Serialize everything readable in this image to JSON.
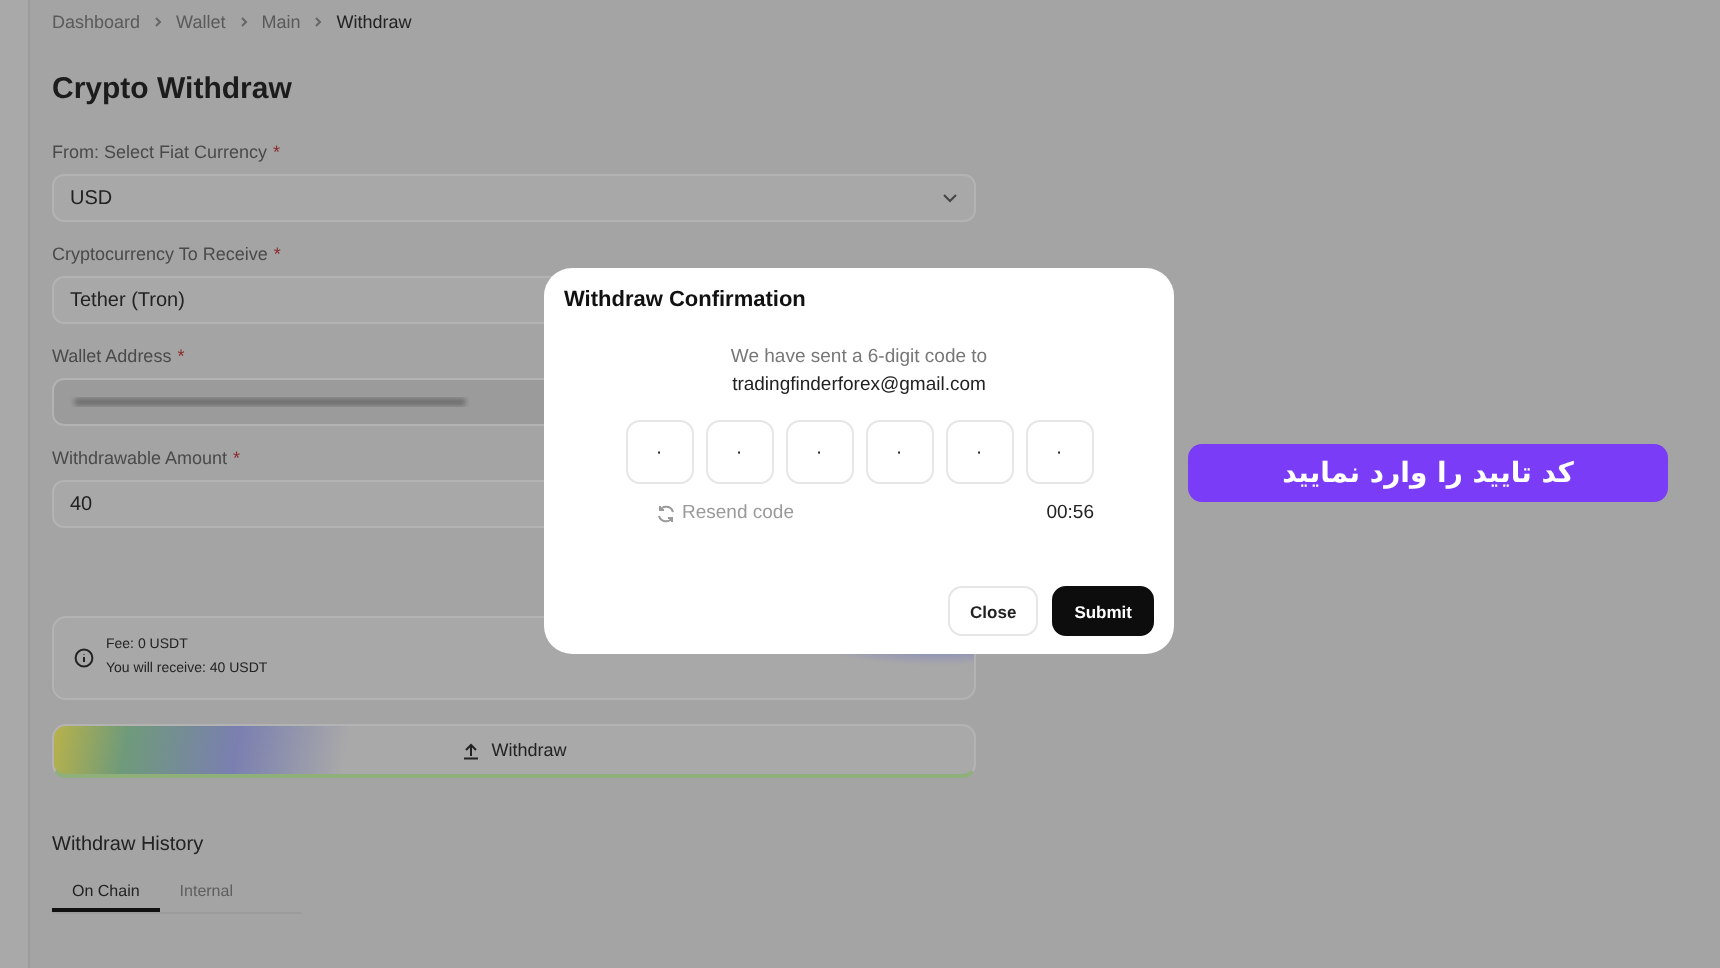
{
  "breadcrumb": [
    "Dashboard",
    "Wallet",
    "Main",
    "Withdraw"
  ],
  "page_title": "Crypto Withdraw",
  "form": {
    "fields": [
      {
        "kind": "select",
        "label": "From: Select Fiat Currency",
        "required_mark": "*",
        "value": "USD"
      },
      {
        "kind": "text",
        "label": "Cryptocurrency To Receive",
        "required_mark": "*",
        "value": "Tether (Tron)"
      },
      {
        "kind": "hidden",
        "label": "Wallet Address",
        "required_mark": "*"
      },
      {
        "kind": "text",
        "label": "Withdrawable Amount",
        "required_mark": "*",
        "value": "40"
      }
    ]
  },
  "summary": {
    "fee": "Fee: 0 USDT",
    "receive": "You will receive: 40 USDT"
  },
  "withdraw_button": "Withdraw",
  "history": {
    "title": "Withdraw History",
    "tabs": [
      {
        "label": "On Chain",
        "selected": true
      },
      {
        "label": "Internal",
        "selected": false
      }
    ]
  },
  "dialog": {
    "title": "Withdraw Confirmation",
    "message": "We have sent a 6-digit code to",
    "email": "tradingfinderforex@gmail.com",
    "code_boxes": [
      {
        "placeholder": "·"
      },
      {
        "placeholder": "·"
      },
      {
        "placeholder": "·"
      },
      {
        "placeholder": "·"
      },
      {
        "placeholder": "·"
      },
      {
        "placeholder": "·"
      }
    ],
    "resend": {
      "label": "Resend code",
      "disabled": true
    },
    "timer": "00:56",
    "buttons": [
      {
        "label": "Close",
        "kind": "secondary"
      },
      {
        "label": "Submit",
        "kind": "primary"
      }
    ]
  },
  "callout": "کد تایید را وارد نمایید"
}
